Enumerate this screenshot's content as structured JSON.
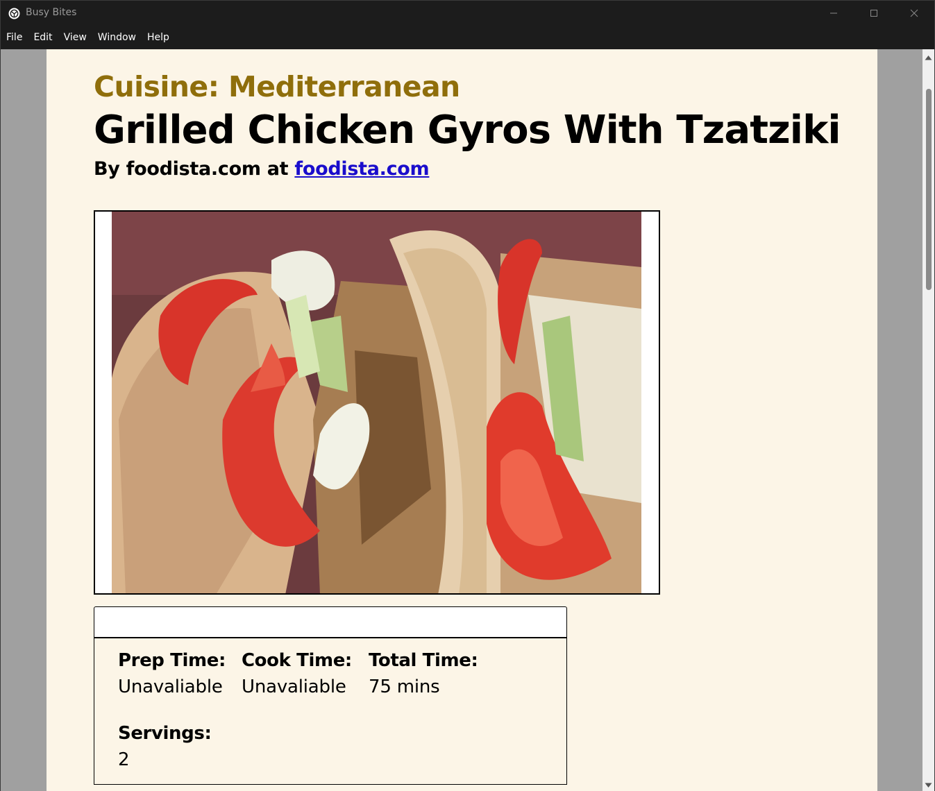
{
  "window": {
    "title": "Busy Bites",
    "icon": "app-logo-icon",
    "controls": [
      "minimize-icon",
      "maximize-icon",
      "close-icon"
    ]
  },
  "menu": {
    "items": [
      "File",
      "Edit",
      "View",
      "Window",
      "Help"
    ]
  },
  "recipe": {
    "cuisine": "Cuisine: Mediterranean",
    "title": "Grilled Chicken Gyros With Tzatziki",
    "byline_prefix": "By foodista.com at ",
    "source_link": "foodista.com",
    "image_alt": "Grilled chicken gyros with tomato, lettuce and tzatziki in pita"
  },
  "info": {
    "prep_label": "Prep Time:",
    "prep_value": "Unavaliable",
    "cook_label": "Cook Time:",
    "cook_value": "Unavaliable",
    "total_label": "Total Time:",
    "total_value": "75 mins",
    "servings_label": "Servings:",
    "servings_value": "2"
  },
  "colors": {
    "cuisine": "#8f6e0b",
    "page_background": "#fcf5e7",
    "titlebar": "#1c1c1c",
    "link": "#1a0dcc",
    "outer_background": "#a0a0a0"
  }
}
